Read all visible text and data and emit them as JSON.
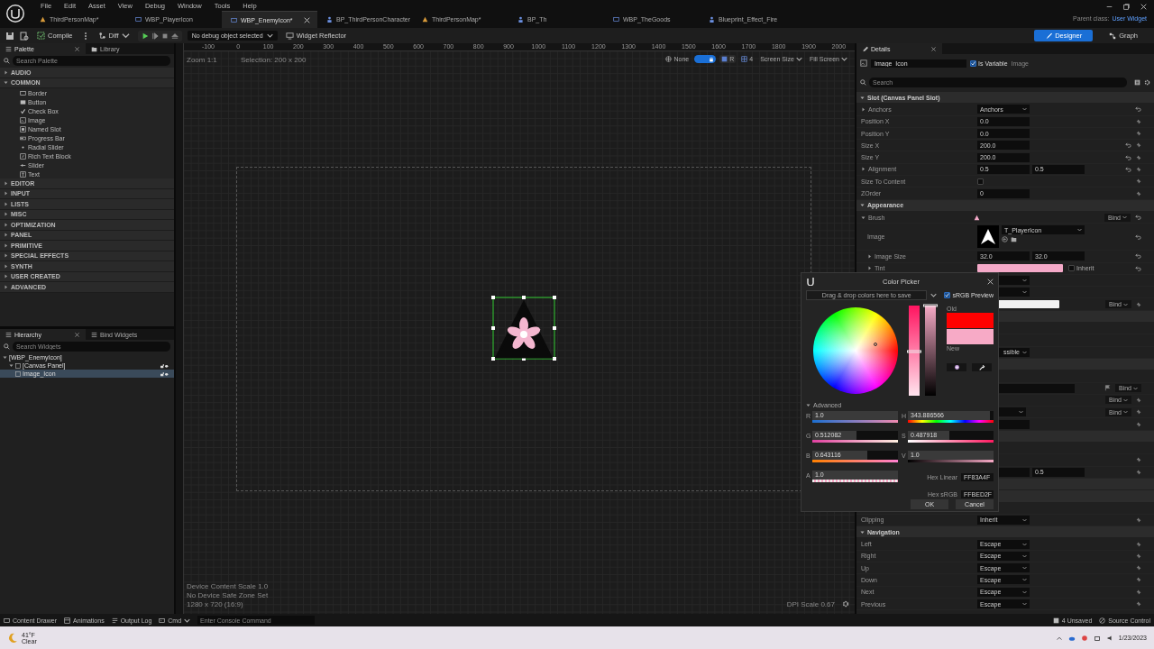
{
  "menu": [
    "File",
    "Edit",
    "Asset",
    "View",
    "Debug",
    "Window",
    "Tools",
    "Help"
  ],
  "tabs": [
    {
      "label": "ThirdPersonMap*",
      "kind": "map",
      "selected": false
    },
    {
      "label": "WBP_PlayerIcon",
      "kind": "widget",
      "selected": false
    },
    {
      "label": "WBP_EnemyIcon*",
      "kind": "widget",
      "selected": true
    },
    {
      "label": "BP_ThirdPersonCharacter",
      "kind": "blueprint",
      "selected": false
    },
    {
      "label": "ThirdPersonMap*",
      "kind": "map",
      "selected": false
    },
    {
      "label": "BP_Th",
      "kind": "blueprint",
      "selected": false
    },
    {
      "label": "WBP_TheGoods",
      "kind": "widget",
      "selected": false
    },
    {
      "label": "Blueprint_Effect_Fire",
      "kind": "blueprint",
      "selected": false
    }
  ],
  "parent_class": {
    "label": "Parent class:",
    "value": "User Widget"
  },
  "toolbar": {
    "compile": "Compile",
    "diff": "Diff",
    "debug_object": "No debug object selected",
    "reflector": "Widget Reflector",
    "modes": [
      {
        "label": "Designer",
        "selected": true
      },
      {
        "label": "Graph",
        "selected": false
      }
    ]
  },
  "palette": {
    "tabs": [
      {
        "label": "Palette",
        "selected": true
      },
      {
        "label": "Library",
        "selected": false
      }
    ],
    "search": {
      "placeholder": "Search Palette"
    },
    "categories": [
      {
        "label": "AUDIO",
        "expanded": false
      },
      {
        "label": "COMMON",
        "expanded": true,
        "children": [
          {
            "label": "Border"
          },
          {
            "label": "Button"
          },
          {
            "label": "Check Box"
          },
          {
            "label": "Image"
          },
          {
            "label": "Named Slot"
          },
          {
            "label": "Progress Bar"
          },
          {
            "label": "Radial Slider"
          },
          {
            "label": "Rich Text Block"
          },
          {
            "label": "Slider"
          },
          {
            "label": "Text"
          }
        ]
      },
      {
        "label": "EDITOR",
        "expanded": false
      },
      {
        "label": "INPUT",
        "expanded": false
      },
      {
        "label": "LISTS",
        "expanded": false
      },
      {
        "label": "MISC",
        "expanded": false
      },
      {
        "label": "OPTIMIZATION",
        "expanded": false
      },
      {
        "label": "PANEL",
        "expanded": false
      },
      {
        "label": "PRIMITIVE",
        "expanded": false
      },
      {
        "label": "SPECIAL EFFECTS",
        "expanded": false
      },
      {
        "label": "SYNTH",
        "expanded": false
      },
      {
        "label": "USER CREATED",
        "expanded": false
      },
      {
        "label": "ADVANCED",
        "expanded": false
      }
    ]
  },
  "hierarchy": {
    "tabs": [
      {
        "label": "Hierarchy",
        "selected": true
      },
      {
        "label": "Bind Widgets",
        "selected": false
      }
    ],
    "search": {
      "placeholder": "Search Widgets"
    },
    "tree": [
      {
        "label": "[WBP_EnemyIcon]",
        "selected": false,
        "children": [
          {
            "label": "[Canvas Panel]",
            "selected": false,
            "children": [
              {
                "label": "Image_Icon",
                "selected": true
              }
            ]
          }
        ]
      }
    ]
  },
  "viewport": {
    "zoom": "Zoom 1:1",
    "selection": "Selection: 200 x 200",
    "view_options": [
      {
        "kind": "dropdown",
        "text": "None"
      },
      {
        "kind": "toggle",
        "on": true
      },
      {
        "kind": "key",
        "text": "R"
      },
      {
        "kind": "grid",
        "text": "4"
      },
      {
        "kind": "dropdown",
        "text": "Screen Size"
      },
      {
        "kind": "dropdown",
        "text": "Fill Screen"
      }
    ],
    "ruler": [
      "-100",
      "0",
      "100",
      "200",
      "300",
      "400",
      "500",
      "600",
      "700",
      "800",
      "900",
      "1000",
      "1100",
      "1200",
      "1300",
      "1400",
      "1500",
      "1600",
      "1700",
      "1800",
      "1900",
      "2000"
    ],
    "info": [
      "Device Content Scale 1.0",
      "No Device Safe Zone Set",
      "1280 x 720 (16:9)"
    ],
    "dpi": "DPI Scale 0.67"
  },
  "details": {
    "title": "Details",
    "widget_name": "Image_Icon",
    "is_variable": {
      "label": "Is Variable",
      "checked": true
    },
    "widget_type": "Image",
    "search": {
      "placeholder": "Search"
    },
    "rows": [
      {
        "kind": "section",
        "label": "Slot (Canvas Panel Slot)"
      },
      {
        "kind": "prop",
        "label": "Anchors",
        "expanded": false,
        "values": [
          {
            "kind": "dropdown",
            "text": "Anchors"
          }
        ],
        "reset": true
      },
      {
        "kind": "prop",
        "label": "Position X",
        "values": [
          {
            "kind": "number",
            "text": "0.0"
          }
        ],
        "pin": true
      },
      {
        "kind": "prop",
        "label": "Position Y",
        "values": [
          {
            "kind": "number",
            "text": "0.0"
          }
        ],
        "pin": true
      },
      {
        "kind": "prop",
        "label": "Size X",
        "values": [
          {
            "kind": "number",
            "text": "200.0"
          }
        ],
        "reset": true,
        "pin": true
      },
      {
        "kind": "prop",
        "label": "Size Y",
        "values": [
          {
            "kind": "number",
            "text": "200.0"
          }
        ],
        "reset": true,
        "pin": true
      },
      {
        "kind": "prop",
        "label": "Alignment",
        "expanded": false,
        "values": [
          {
            "kind": "number",
            "text": "0.5"
          },
          {
            "kind": "number",
            "text": "0.5"
          }
        ],
        "reset": true,
        "pin": true
      },
      {
        "kind": "prop",
        "label": "Size To Content",
        "values": [
          {
            "kind": "checkbox",
            "checked": false
          }
        ],
        "pin": true
      },
      {
        "kind": "prop",
        "label": "ZOrder",
        "values": [
          {
            "kind": "number",
            "text": "0"
          }
        ],
        "pin": true
      },
      {
        "kind": "section",
        "label": "Appearance"
      },
      {
        "kind": "prop",
        "label": "Brush",
        "expanded": true,
        "values": [
          {
            "kind": "brush"
          }
        ],
        "bind": "Bind",
        "reset": true,
        "children": [
          {
            "kind": "prop",
            "label": "Image",
            "values": [
              {
                "kind": "texture",
                "text": "T_PlayerIcon"
              }
            ],
            "reset": true
          },
          {
            "kind": "prop",
            "label": "Image Size",
            "expanded": false,
            "values": [
              {
                "kind": "number",
                "text": "32.0"
              },
              {
                "kind": "number",
                "text": "32.0"
              }
            ],
            "reset": true
          },
          {
            "kind": "prop",
            "label": "Tint",
            "expanded": false,
            "values": [
              {
                "kind": "swatch",
                "color": "#f4a9c8"
              },
              {
                "kind": "inherit",
                "text": "Inherit",
                "checked": false
              }
            ],
            "reset": true
          }
        ]
      },
      {
        "kind": "prop",
        "values": [
          {
            "kind": "dropdown"
          }
        ]
      },
      {
        "kind": "prop",
        "values": [
          {
            "kind": "dropdown"
          }
        ]
      },
      {
        "kind": "prop",
        "values": [
          {
            "kind": "swatch",
            "color": "#f2f2f2"
          }
        ],
        "bind": "Bind",
        "pin": true
      },
      {
        "kind": "section"
      },
      {
        "kind": "prop",
        "values": []
      },
      {
        "kind": "prop",
        "values": []
      },
      {
        "kind": "prop",
        "values": [
          {
            "kind": "dropdown",
            "text": "ssible"
          }
        ]
      },
      {
        "kind": "section"
      },
      {
        "kind": "prop",
        "values": []
      },
      {
        "kind": "prop",
        "values": [
          {
            "kind": "wide"
          }
        ],
        "flag": true,
        "bind": "Bind"
      },
      {
        "kind": "prop",
        "values": [],
        "bind": "Bind",
        "pin": true
      },
      {
        "kind": "prop",
        "values": [
          {
            "kind": "dropdown"
          }
        ],
        "bind": "Bind",
        "pin": true
      },
      {
        "kind": "prop",
        "values": [
          {
            "kind": "number"
          }
        ],
        "pin": true
      },
      {
        "kind": "section"
      },
      {
        "kind": "prop",
        "values": []
      },
      {
        "kind": "prop",
        "values": [],
        "pin": true
      },
      {
        "kind": "prop",
        "values": [
          {
            "kind": "number"
          },
          {
            "kind": "number",
            "text": "0.5"
          }
        ],
        "pin": true
      },
      {
        "kind": "section"
      },
      {
        "kind": "section"
      },
      {
        "kind": "prop",
        "values": []
      },
      {
        "kind": "prop",
        "label": "Clipping",
        "values": [
          {
            "kind": "dropdown",
            "text": "Inherit"
          }
        ],
        "pin": true
      },
      {
        "kind": "section",
        "label": "Navigation"
      },
      {
        "kind": "prop",
        "label": "Left",
        "values": [
          {
            "kind": "dropdown",
            "text": "Escape"
          }
        ],
        "pin": true
      },
      {
        "kind": "prop",
        "label": "Right",
        "values": [
          {
            "kind": "dropdown",
            "text": "Escape"
          }
        ],
        "pin": true
      },
      {
        "kind": "prop",
        "label": "Up",
        "values": [
          {
            "kind": "dropdown",
            "text": "Escape"
          }
        ],
        "pin": true
      },
      {
        "kind": "prop",
        "label": "Down",
        "values": [
          {
            "kind": "dropdown",
            "text": "Escape"
          }
        ],
        "pin": true
      },
      {
        "kind": "prop",
        "label": "Next",
        "values": [
          {
            "kind": "dropdown",
            "text": "Escape"
          }
        ],
        "pin": true
      },
      {
        "kind": "prop",
        "label": "Previous",
        "values": [
          {
            "kind": "dropdown",
            "text": "Escape"
          }
        ],
        "pin": true
      }
    ]
  },
  "color_picker": {
    "title": "Color Picker",
    "swatch_hint": "Drag & drop colors here to save",
    "srgb_preview": {
      "label": "sRGB Preview",
      "checked": true
    },
    "saturation_bar": {
      "level": 0.488
    },
    "value_bar": {
      "level": 1.0
    },
    "swatches": [
      {
        "label": "Old",
        "color": "#ff0000"
      },
      {
        "label": "New",
        "color": "#f7aac6"
      }
    ],
    "advanced": {
      "label": "Advanced",
      "expanded": true
    },
    "rgba": [
      {
        "name": "R",
        "value": "1.0",
        "level": 1.0
      },
      {
        "name": "G",
        "value": "0.512082",
        "level": 0.512
      },
      {
        "name": "B",
        "value": "0.643116",
        "level": 0.643
      },
      {
        "name": "A",
        "value": "1.0",
        "level": 1.0
      }
    ],
    "hsv": [
      {
        "name": "H",
        "value": "343.886566",
        "level": 0.955
      },
      {
        "name": "S",
        "value": "0.487918",
        "level": 0.488
      },
      {
        "name": "V",
        "value": "1.0",
        "level": 1.0
      }
    ],
    "hex": [
      {
        "label": "Hex Linear",
        "value": "FF83A4F"
      },
      {
        "label": "Hex sRGB",
        "value": "FFBED2F"
      }
    ],
    "buttons": [
      "OK",
      "Cancel"
    ]
  },
  "bottom_bar": {
    "items": [
      "Content Drawer",
      "Animations",
      "Output Log"
    ],
    "cmd": "Cmd",
    "console": {
      "placeholder": "Enter Console Command"
    },
    "unsaved": "4 Unsaved",
    "source_control": "Source Control"
  },
  "taskbar": {
    "temperature": "41°F",
    "weather": "Clear",
    "date": "1/23/2023"
  }
}
